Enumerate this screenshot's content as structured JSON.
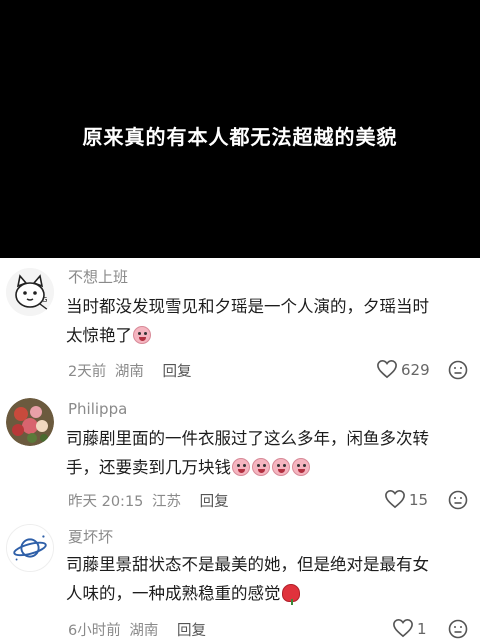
{
  "banner": {
    "title": "原来真的有本人都无法超越的美貌"
  },
  "comments": [
    {
      "username": "不想上班",
      "text_lines": [
        "当时都没发现雪见和夕瑶是一个人演的，夕瑶当时",
        "太惊艳了"
      ],
      "emoji": [
        "crying-laughing"
      ],
      "time": "2天前",
      "location": "湖南",
      "reply_label": "回复",
      "likes": "629",
      "avatar_icon": "cartoon-animal-avatar"
    },
    {
      "username": "Philippa",
      "text_lines": [
        "司藤剧里面的一件衣服过了这么多年，闲鱼多次转",
        "手，还要卖到几万块钱"
      ],
      "emoji": [
        "crying-laughing",
        "crying-laughing",
        "crying-laughing",
        "crying-laughing"
      ],
      "time": "昨天 20:15",
      "location": "江苏",
      "reply_label": "回复",
      "likes": "15",
      "avatar_icon": "flower-photo-avatar"
    },
    {
      "username": "夏坏坏",
      "text_lines": [
        "司藤里景甜状态不是最美的她，但是绝对是最有女",
        "人味的，一种成熟稳重的感觉"
      ],
      "emoji": [
        "rose"
      ],
      "time": "6小时前",
      "location": "湖南",
      "reply_label": "回复",
      "likes": "1",
      "avatar_icon": "planet-avatar"
    }
  ],
  "colors": {
    "banner": "#000000",
    "text": "#1c1c1c",
    "meta": "#8a8a8a"
  }
}
